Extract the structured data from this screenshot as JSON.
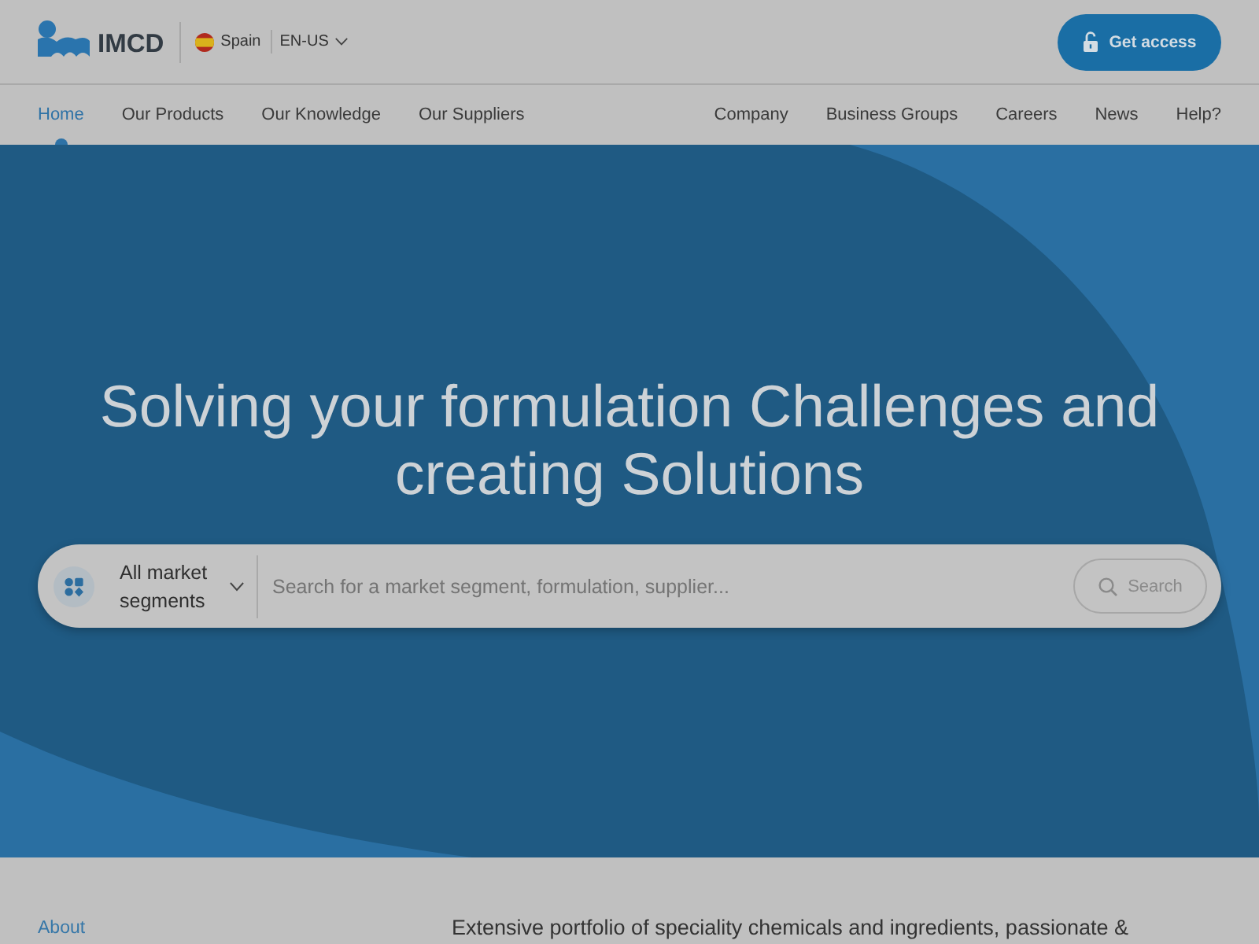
{
  "header": {
    "logo_text": "IMCD",
    "country": "Spain",
    "language": "EN-US",
    "cta_button": "Get access"
  },
  "nav": {
    "left": [
      {
        "label": "Home",
        "selected": true
      },
      {
        "label": "Our Products",
        "selected": false
      },
      {
        "label": "Our Knowledge",
        "selected": false
      },
      {
        "label": "Our Suppliers",
        "selected": false
      }
    ],
    "right": [
      {
        "label": "Company",
        "selected": false
      },
      {
        "label": "Business Groups",
        "selected": false
      },
      {
        "label": "Careers",
        "selected": false
      },
      {
        "label": "News",
        "selected": false
      },
      {
        "label": "Help?",
        "selected": false
      }
    ]
  },
  "hero": {
    "title": "Solving your formulation Challenges and creating Solutions",
    "search": {
      "segment": "All market segments",
      "placeholder": "Search for a market segment, formulation, supplier...",
      "button": "Search"
    }
  },
  "about": {
    "label": "About",
    "text": "Extensive portfolio of speciality chemicals and ingredients, passionate &"
  }
}
